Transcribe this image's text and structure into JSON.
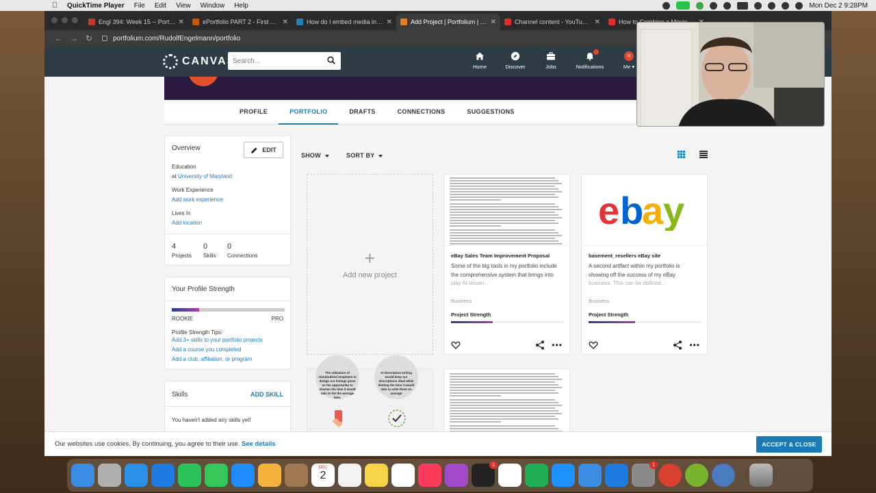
{
  "menubar": {
    "app": "QuickTime Player",
    "items": [
      "File",
      "Edit",
      "View",
      "Window",
      "Help"
    ],
    "datetime": "Mon Dec 2  9:28PM"
  },
  "browser": {
    "tabs": [
      {
        "title": "Engl 394: Week 15 -- Portfolio",
        "color": "#c0392b"
      },
      {
        "title": "ePortfolio PART 2 - First Draft",
        "color": "#d35400"
      },
      {
        "title": "How do I embed media in my",
        "color": "#2980b9"
      },
      {
        "title": "Add Project | Portfolium | Portfolio",
        "color": "#e67e22"
      },
      {
        "title": "Channel content - YouTube Studio",
        "color": "#e52d27"
      },
      {
        "title": "How to Combine a Movie and",
        "color": "#e52d27"
      }
    ],
    "url": "portfolium.com/RudolfEngelmann/portfolio"
  },
  "header": {
    "brand": "CANVAS",
    "search_placeholder": "Search...",
    "nav": [
      {
        "label": "Home",
        "icon": "home-icon"
      },
      {
        "label": "Discover",
        "icon": "compass-icon"
      },
      {
        "label": "Jobs",
        "icon": "briefcase-icon"
      },
      {
        "label": "Notifications",
        "icon": "bell-icon"
      },
      {
        "label": "Me",
        "icon": "avatar"
      }
    ],
    "avatar_initial": "R"
  },
  "profile_tabs": [
    "PROFILE",
    "PORTFOLIO",
    "DRAFTS",
    "CONNECTIONS",
    "SUGGESTIONS"
  ],
  "active_tab": "PORTFOLIO",
  "overview": {
    "title": "Overview",
    "edit_label": "EDIT",
    "education_label": "Education",
    "education_prefix": "at",
    "education_value": "University of Maryland",
    "work_label": "Work Experience",
    "work_link": "Add work experience",
    "lives_label": "Lives In",
    "lives_link": "Add location",
    "stats": [
      {
        "num": "4",
        "label": "Projects"
      },
      {
        "num": "0",
        "label": "Skills"
      },
      {
        "num": "0",
        "label": "Connections"
      }
    ]
  },
  "strength": {
    "title": "Your Profile Strength",
    "level_low": "ROOKIE",
    "level_high": "PRO",
    "progress": 0.24,
    "tips_title": "Profile Strength Tips:",
    "tips": [
      "Add 3+ skills to your portfolio projects",
      "Add a course you completed",
      "Add a club, affiliation, or program"
    ]
  },
  "skills": {
    "title": "Skills",
    "add_label": "ADD SKILL",
    "empty": "You haven't added any skills yet!"
  },
  "toolbar": {
    "show": "SHOW",
    "sort": "SORT BY"
  },
  "add_new": "Add new project",
  "projects": [
    {
      "title": "eBay Sales Team Improvement Proposal",
      "desc": "Some of the big tools in my portfolio include the comprehensive system that brings into",
      "desc_fade": "play AI-driven...",
      "category": "Business",
      "strength_label": "Project Strength",
      "strength": 0.37
    },
    {
      "title": "basement_resellers eBay site",
      "desc": "A second artifact within my portfolio is showing off the success of my eBay",
      "desc_fade": "business. This can be defined...",
      "category": "Business",
      "strength_label": "Project Strength",
      "strength": 0.41,
      "logo": "ebay"
    }
  ],
  "thumb3": {
    "bubble1": "The utilization of standardized templates to design our listings gives us the opportunity to shorten the time it would take to list the average item.",
    "bubble2": "AI description writing would keep our descriptions ideal while limiting the time it would take to write them on average"
  },
  "cookie": {
    "text": "Our websites use cookies. By continuing, you agree to their use.",
    "link": "See details",
    "button": "ACCEPT & CLOSE"
  },
  "calendar": {
    "month": "DEC",
    "day": "2"
  },
  "dock_badges": {
    "tv": "1",
    "settings": "1"
  }
}
